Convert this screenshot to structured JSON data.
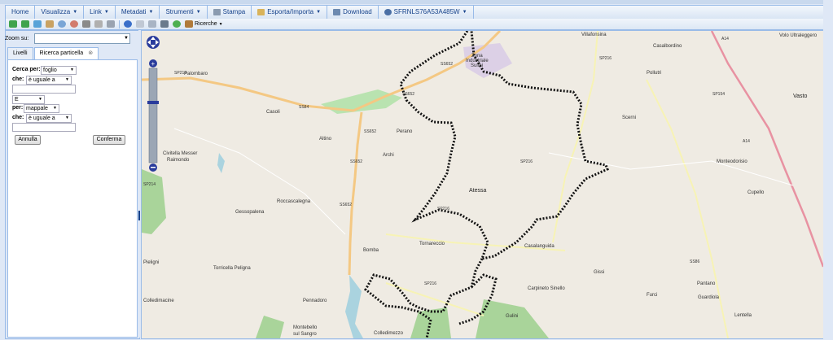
{
  "menubar": {
    "items": [
      {
        "label": "Home",
        "arrow": false
      },
      {
        "label": "Visualizza",
        "arrow": true
      },
      {
        "label": "Link",
        "arrow": true
      },
      {
        "label": "Metadati",
        "arrow": true
      },
      {
        "label": "Strumenti",
        "arrow": true
      },
      {
        "label": "Stampa",
        "arrow": false,
        "icon": "printer-icon"
      },
      {
        "label": "Esporta/Importa",
        "arrow": true,
        "icon": "export-icon"
      },
      {
        "label": "Download",
        "arrow": false,
        "icon": "download-icon"
      },
      {
        "label": "SFRNLS76A53A485W",
        "arrow": true,
        "icon": "user-icon"
      }
    ]
  },
  "toolbar": {
    "icons": [
      "back-icon",
      "forward-icon",
      "zoom-extent-icon",
      "pan-icon",
      "zoom-in-icon",
      "zoom-out-icon",
      "measure-icon",
      "measure-area-icon",
      "print-icon",
      "info-icon",
      "edit-icon",
      "copy-icon",
      "car-icon",
      "globe-icon",
      "binoculars-icon"
    ],
    "ricerche_label": "Ricerche"
  },
  "left": {
    "zoom_label": "Zoom su:",
    "zoom_value": "",
    "tabs": {
      "livelli": "Livelli",
      "ricerca": "Ricerca particella"
    },
    "form": {
      "cerca_per_label": "Cerca per:",
      "cerca_per_value": "foglio",
      "che1_label": "che:",
      "che1_value": "è uguale a",
      "input1": "",
      "operator_value": "E",
      "per_label": "per:",
      "per_value": "mappale",
      "che2_label": "che:",
      "che2_value": "è uguale a",
      "input2": "",
      "annulla": "Annulla",
      "conferma": "Conferma"
    }
  },
  "map": {
    "places": [
      "Villafonsina",
      "Casalbordino",
      "Pollutri",
      "Scerni",
      "Vasto",
      "Monteodorisio",
      "Cupello",
      "Palombaro",
      "Casoli",
      "Altino",
      "Perano",
      "Archi",
      "Civitella Messer Raimondo",
      "Atessa",
      "Roccascalegna",
      "Gessopalena",
      "Bomba",
      "Tornareccio",
      "Casalanguida",
      "Gissi",
      "Torricella Peligna",
      "Carpineto Sinello",
      "Pantano",
      "Furci",
      "Guardiola",
      "Lentella",
      "Colledimacine",
      "Pennadoro",
      "Montebello sul Sangro",
      "Colledimezzo",
      "Gulini",
      "Pieligni",
      "Zona Industriale Sulmi",
      "Volo Ultraleggero"
    ],
    "roads": [
      "SS652",
      "SP214",
      "SS84",
      "SP216",
      "SP154",
      "A14",
      "SS86",
      "SP216"
    ],
    "colors": {
      "boundary": "#111111",
      "forest": "#a9d49a",
      "water": "#aad3df",
      "road_main": "#f4c883",
      "road_secondary": "#f7f3b5",
      "motorway": "#e892a2"
    }
  }
}
